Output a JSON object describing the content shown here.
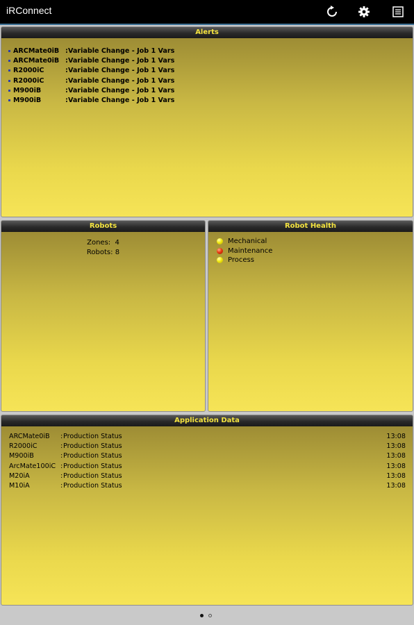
{
  "app": {
    "title": "iRConnect"
  },
  "toolbar": {
    "refresh_icon": "refresh-icon",
    "settings_icon": "gear-icon",
    "menu_icon": "list-icon"
  },
  "alerts": {
    "title": "Alerts",
    "separator": ":",
    "items": [
      {
        "robot": "ARCMate0iB",
        "message": "Variable Change - Job 1 Vars"
      },
      {
        "robot": "ARCMate0iB",
        "message": "Variable Change - Job 1 Vars"
      },
      {
        "robot": "R2000iC",
        "message": "Variable Change - Job 1 Vars"
      },
      {
        "robot": "R2000iC",
        "message": "Variable Change - Job 1 Vars"
      },
      {
        "robot": "M900iB",
        "message": "Variable Change - Job 1 Vars"
      },
      {
        "robot": "M900iB",
        "message": "Variable Change - Job 1 Vars"
      }
    ]
  },
  "robots": {
    "title": "Robots",
    "zones_label": "Zones:",
    "zones_value": "4",
    "robots_label": "Robots:",
    "robots_value": "8"
  },
  "robot_health": {
    "title": "Robot Health",
    "items": [
      {
        "label": "Mechanical",
        "status_color": "#f2ea10"
      },
      {
        "label": "Maintenance",
        "status_color": "#e83a10"
      },
      {
        "label": "Process",
        "status_color": "#f2ea10"
      }
    ]
  },
  "application_data": {
    "title": "Application Data",
    "separator": ":",
    "rows": [
      {
        "robot": "ARCMate0iB",
        "status": "Production Status",
        "time": "13:08"
      },
      {
        "robot": "R2000iC",
        "status": "Production Status",
        "time": "13:08"
      },
      {
        "robot": "M900iB",
        "status": "Production Status",
        "time": "13:08"
      },
      {
        "robot": "ArcMate100iC",
        "status": "Production Status",
        "time": "13:08"
      },
      {
        "robot": "M20iA",
        "status": "Production Status",
        "time": "13:08"
      },
      {
        "robot": "M10iA",
        "status": "Production Status",
        "time": "13:08"
      }
    ]
  },
  "pager": {
    "total_pages": 2,
    "current_page": 1
  },
  "colors": {
    "header_text": "#f4e33f",
    "appbar_bg": "#000000",
    "panel_top": "#968532",
    "panel_bottom": "#f6e457"
  }
}
